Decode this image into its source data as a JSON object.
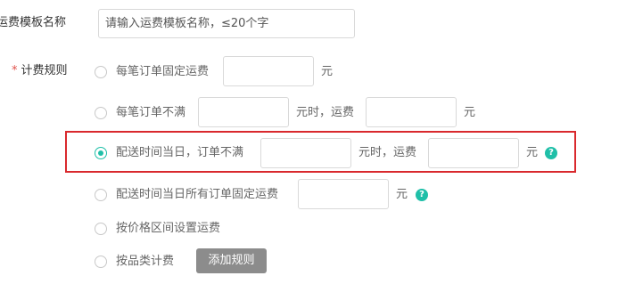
{
  "template_name": {
    "label": "运费模板名称",
    "placeholder": "请输入运费模板名称，≤20个字"
  },
  "billing_rule": {
    "required_mark": "*",
    "label": "计费规则",
    "options": [
      {
        "text": "每笔订单固定运费",
        "unit": "元",
        "selected": false
      },
      {
        "text": "每笔订单不满",
        "mid": "元时，运费",
        "unit": "元",
        "selected": false
      },
      {
        "text": "配送时间当日，订单不满",
        "mid": "元时，运费",
        "unit": "元",
        "selected": true,
        "help": "?"
      },
      {
        "text": "配送时间当日所有订单固定运费",
        "unit": "元",
        "selected": false,
        "help": "?"
      },
      {
        "text": "按价格区间设置运费",
        "selected": false
      },
      {
        "text": "按品类计费",
        "selected": false
      }
    ],
    "add_rule_button": "添加规则"
  },
  "colors": {
    "accent": "#1fbfa8",
    "highlight": "#d9292d",
    "required": "#e0514a",
    "button": "#8c8c8c"
  }
}
